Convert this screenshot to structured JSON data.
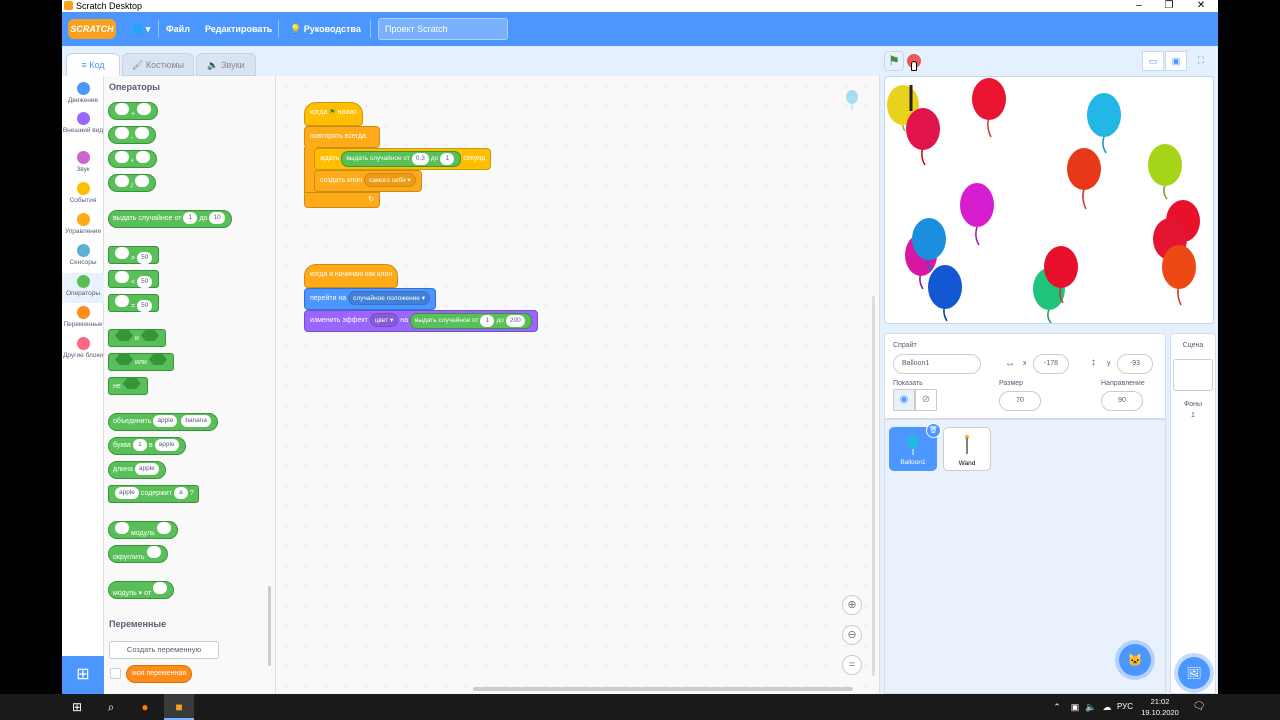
{
  "window": {
    "title": "Scratch Desktop",
    "controls": [
      "–",
      "❐",
      "✕"
    ]
  },
  "menubar": {
    "logo": "SCRATCH",
    "globe": "🌐 ▾",
    "file": "Файл",
    "edit": "Редактировать",
    "tutorials": "Руководства",
    "project_name": "Проект Scratch"
  },
  "tabs": {
    "code": "Код",
    "costumes": "Костюмы",
    "sounds": "Звуки"
  },
  "categories": [
    {
      "label": "Движение",
      "color": "#4c97ff"
    },
    {
      "label": "Внешний вид",
      "color": "#9966ff"
    },
    {
      "label": "Звук",
      "color": "#cf63cf"
    },
    {
      "label": "События",
      "color": "#ffbf00"
    },
    {
      "label": "Управление",
      "color": "#ffab19"
    },
    {
      "label": "Сенсоры",
      "color": "#5cb1d6"
    },
    {
      "label": "Операторы",
      "color": "#59c059"
    },
    {
      "label": "Переменные",
      "color": "#ff8c1a"
    },
    {
      "label": "Другие блоки",
      "color": "#ff6680"
    }
  ],
  "palette": {
    "heading": "Операторы",
    "add": "+",
    "sub": "-",
    "mul": "*",
    "div": "/",
    "random": "выдать случайное от",
    "random_from": "1",
    "random_to_word": "до",
    "random_to": "10",
    "gt": ">",
    "lt": "<",
    "eq": "=",
    "cmp_value": "50",
    "and": "и",
    "or": "или",
    "not": "не",
    "join": "объединить",
    "join_a": "apple",
    "join_b": "banana",
    "letter": "буква",
    "letter_n": "1",
    "letter_of": "в",
    "letter_word": "apple",
    "length": "длина",
    "length_word": "apple",
    "contains_word": "apple",
    "contains": "содержит",
    "contains_char": "a",
    "contains_q": "?",
    "mod": "модуль",
    "round": "округлить",
    "mathop": "модуль ▾",
    "mathop_of": "от",
    "variables_heading": "Переменные",
    "create_var": "Создать переменную",
    "my_var": "моя переменная"
  },
  "script1": {
    "hat": "когда",
    "hat_flag": "⚑",
    "hat_end": "нажат",
    "forever": "повторять всегда",
    "wait": "ждать",
    "wait_random": "выдать случайное от",
    "wait_from": "0.3",
    "wait_to_word": "до",
    "wait_to": "1",
    "wait_unit": "секунд",
    "clone": "создать клон",
    "clone_target": "самого себя ▾",
    "loop_arrow": "↻"
  },
  "script2": {
    "hat": "когда я начинаю как клон",
    "goto": "перейти на",
    "goto_target": "случайное положение ▾",
    "effect": "изменить эффект",
    "effect_type": "цвет ▾",
    "effect_by": "на",
    "effect_random": "выдать случайное от",
    "effect_from": "1",
    "effect_to_word": "до",
    "effect_to": "200"
  },
  "zoom": {
    "in": "⊕",
    "out": "⊖",
    "reset": "="
  },
  "sprite_info": {
    "sprite_label": "Спрайт",
    "sprite_name": "Balloon1",
    "x_label": "x",
    "x_value": "-178",
    "y_label": "y",
    "y_value": "-93",
    "show_label": "Показать",
    "size_label": "Размер",
    "size_value": "70",
    "direction_label": "Направление",
    "direction_value": "90"
  },
  "sprites": [
    {
      "name": "Balloon1",
      "selected": true
    },
    {
      "name": "Wand",
      "selected": false
    }
  ],
  "scene": {
    "label": "Сцена",
    "backdrops_label": "Фоны",
    "backdrops_count": "1"
  },
  "taskbar": {
    "lang": "РУС",
    "time": "21:02",
    "date": "19.10.2020"
  }
}
